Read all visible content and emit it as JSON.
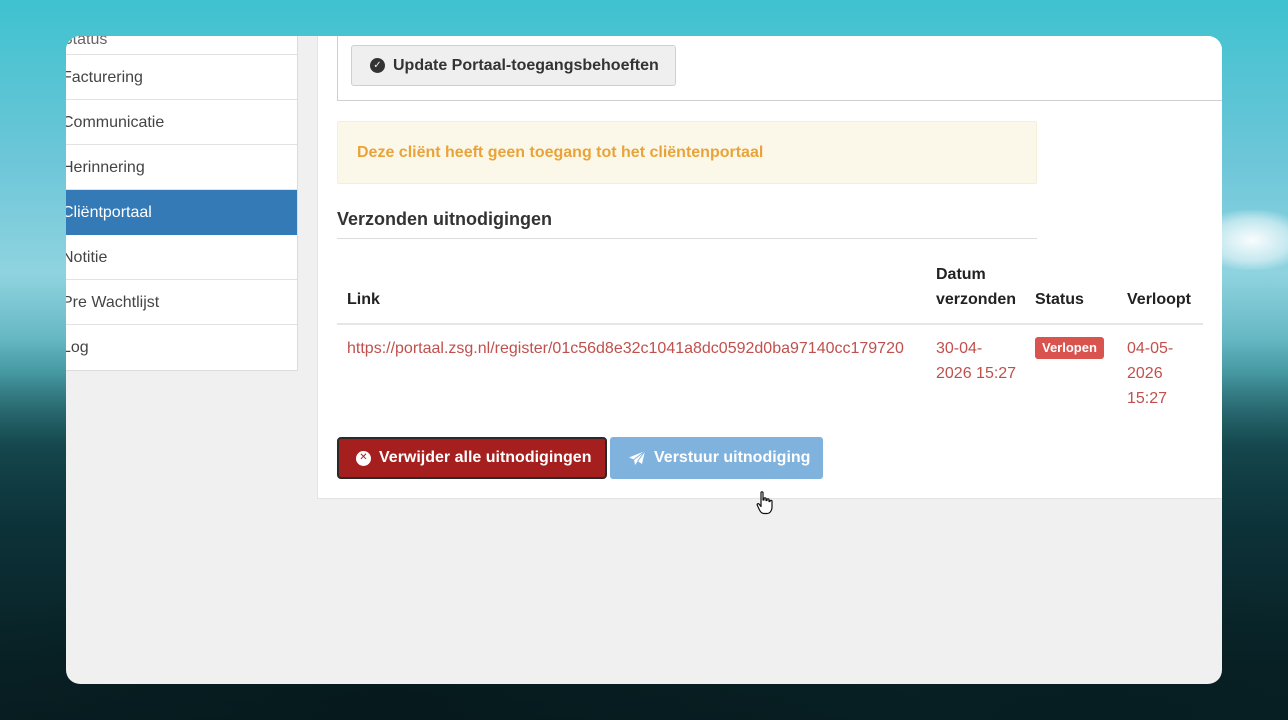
{
  "sidebar": {
    "items": [
      {
        "label": "Status"
      },
      {
        "label": "Facturering"
      },
      {
        "label": "Communicatie"
      },
      {
        "label": "Herinnering"
      },
      {
        "label": "Cliëntportaal"
      },
      {
        "label": "Notitie"
      },
      {
        "label": "Pre Wachtlijst"
      },
      {
        "label": "Log"
      }
    ],
    "active_item": "Cliëntportaal"
  },
  "main": {
    "update_button_label": "Update Portaal-toegangsbehoeften",
    "alert_text": "Deze cliënt heeft geen toegang tot het cliëntenportaal",
    "section_title": "Verzonden uitnodigingen",
    "table": {
      "headers": {
        "link": "Link",
        "date_line1": "Datum",
        "date_line2": "verzonden",
        "status": "Status",
        "expires": "Verloopt"
      },
      "rows": [
        {
          "link": "https://portaal.zsg.nl/register/01c56d8e32c1041a8dc0592d0ba97140cc179720",
          "date_line1": "30-04-",
          "date_line2": "2026 15:27",
          "status": "Verlopen",
          "expires_line1": "04-05-",
          "expires_line2": "2026",
          "expires_line3": "15:27"
        }
      ]
    },
    "delete_button_label": "Verwijder alle uitnodigingen",
    "send_button_label": "Verstuur uitnodiging"
  },
  "colors": {
    "active_sidebar": "#337ab7",
    "danger": "#a51f1f",
    "badge": "#d9534f",
    "alert_text": "#e8a43a",
    "link_text": "#c0504d",
    "send_button": "#7fb2dc"
  },
  "icons": {
    "update": "check-circle-icon",
    "delete": "times-circle-icon",
    "send": "paper-plane-icon",
    "cursor": "hand-pointer-icon"
  }
}
